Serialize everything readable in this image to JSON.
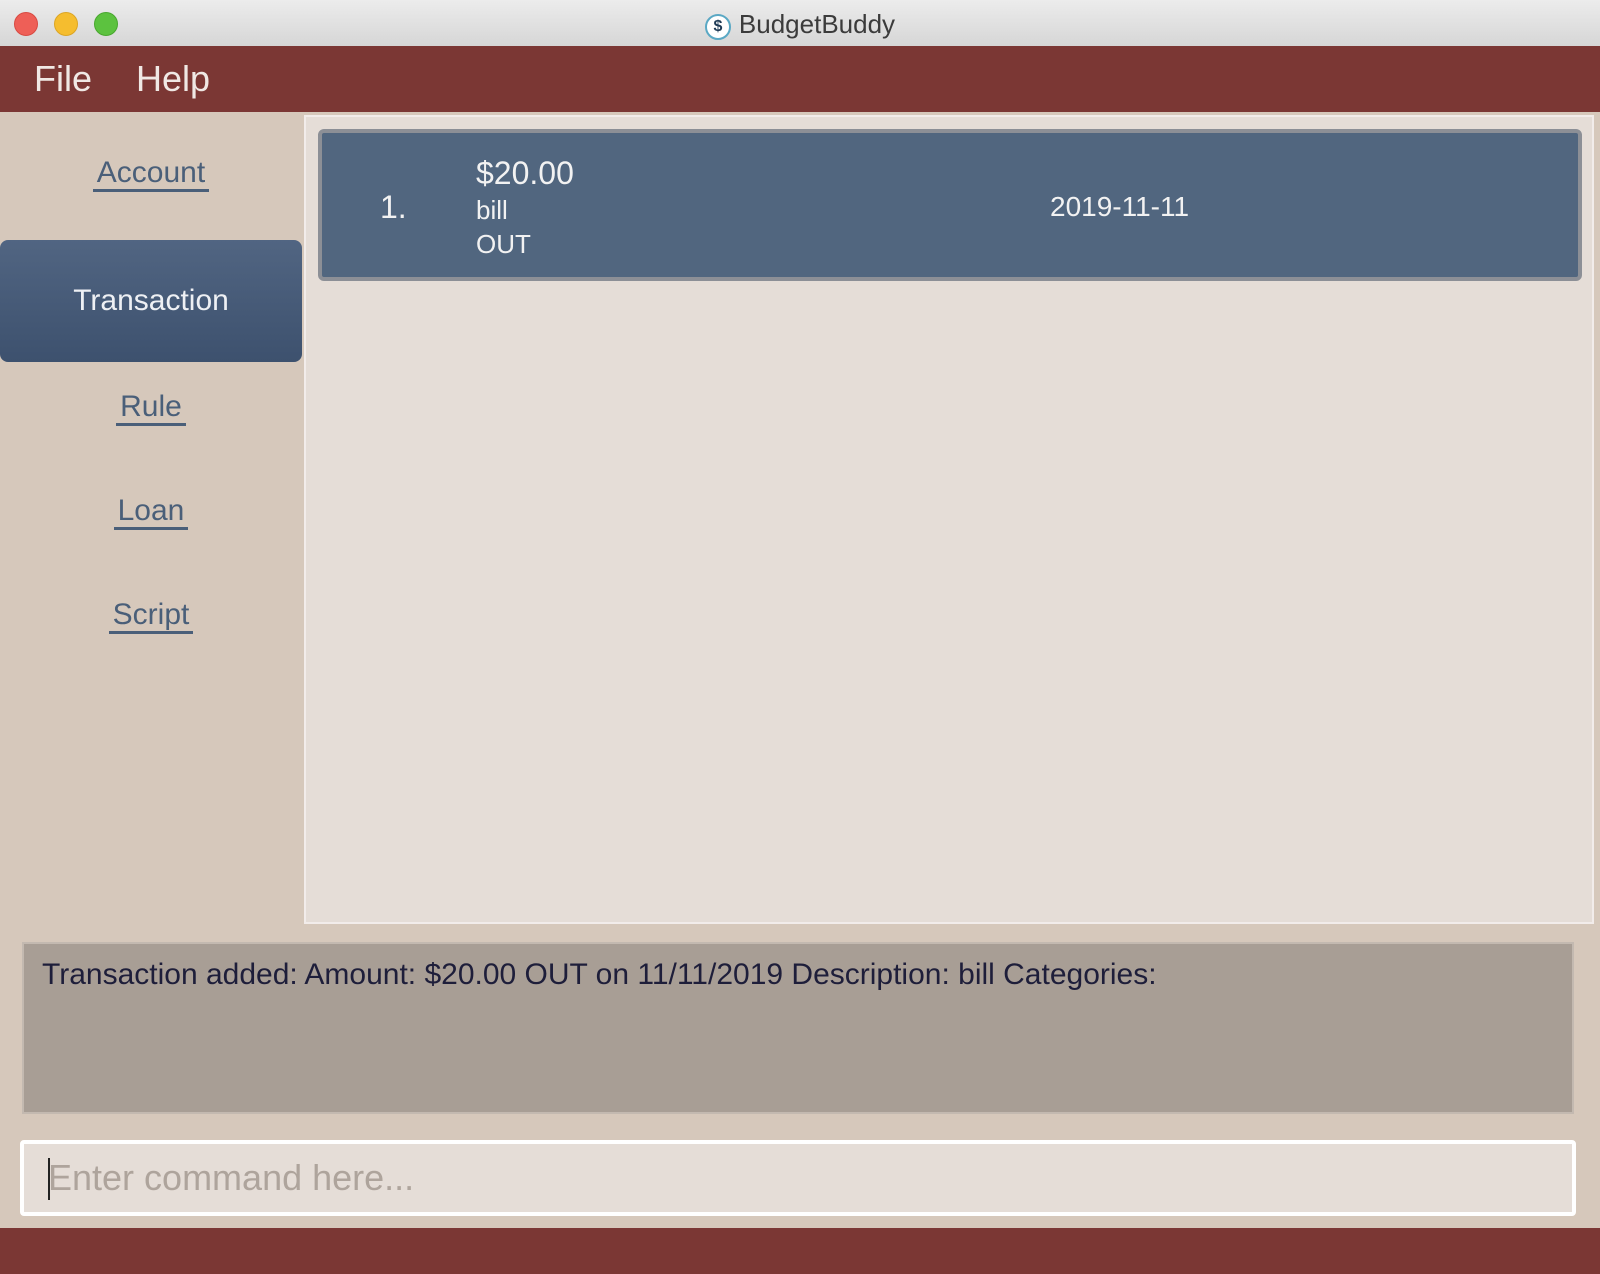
{
  "window": {
    "title": "BudgetBuddy",
    "app_icon_glyph": "$",
    "buttons": [
      "close-button",
      "minimize-button",
      "maximize-button"
    ]
  },
  "menubar": {
    "file": "File",
    "help": "Help"
  },
  "sidebar": {
    "items": [
      {
        "label": "Account"
      },
      {
        "label": "Transaction"
      },
      {
        "label": "Rule"
      },
      {
        "label": "Loan"
      },
      {
        "label": "Script"
      }
    ],
    "active": "Transaction"
  },
  "transactions": [
    {
      "index": "1.",
      "amount": "$20.00",
      "description": "bill",
      "direction": "OUT",
      "date": "2019-11-11"
    }
  ],
  "result": {
    "message": "Transaction added: Amount: $20.00 OUT on 11/11/2019 Description: bill Categories:"
  },
  "command": {
    "placeholder": "Enter command here..."
  },
  "colors": {
    "menubar": "#7b3734",
    "sidebar": "#d6c8bb",
    "card": "#51667f",
    "result_box": "#a89e95"
  }
}
